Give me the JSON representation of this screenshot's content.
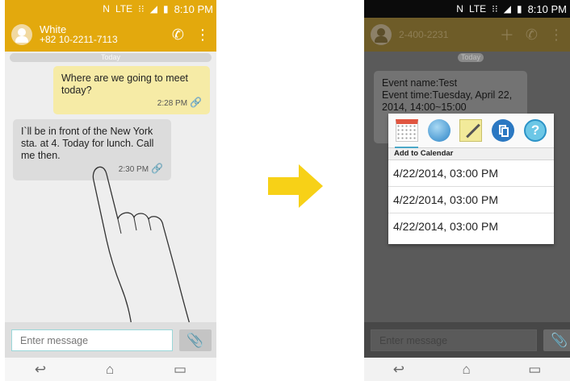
{
  "status": {
    "nfc": "N",
    "network": "LTE",
    "time": "8:10 PM"
  },
  "left": {
    "contact_name": "White",
    "contact_number": "+82 10-2211-7113",
    "date_divider": "Today",
    "messages": [
      {
        "text": "Where are we going to meet today?",
        "time": "2:28 PM",
        "direction": "sent"
      },
      {
        "text": "I`ll be in front of the New York sta. at 4. Today for lunch. Call me then.",
        "time": "2:30 PM",
        "direction": "received"
      }
    ],
    "input_placeholder": "Enter message"
  },
  "right": {
    "contact_number": "2-400-2231",
    "date_divider": "Today",
    "event_text": "Event name:Test\nEvent time:Tuesday, April 22, 2014, 14:00~15:00",
    "popup": {
      "header": "Add to Calendar",
      "icons": [
        "calendar-icon",
        "globe-icon",
        "memo-icon",
        "copy-icon",
        "help-icon"
      ],
      "options": [
        "4/22/2014, 03:00 PM",
        "4/22/2014, 03:00 PM",
        "4/22/2014, 03:00 PM"
      ]
    },
    "input_placeholder": "Enter message"
  },
  "colors": {
    "accent": "#e3a90d",
    "sent_bubble": "#f6eba6",
    "received_bubble": "#dcdcdc",
    "arrow": "#f7d117"
  }
}
